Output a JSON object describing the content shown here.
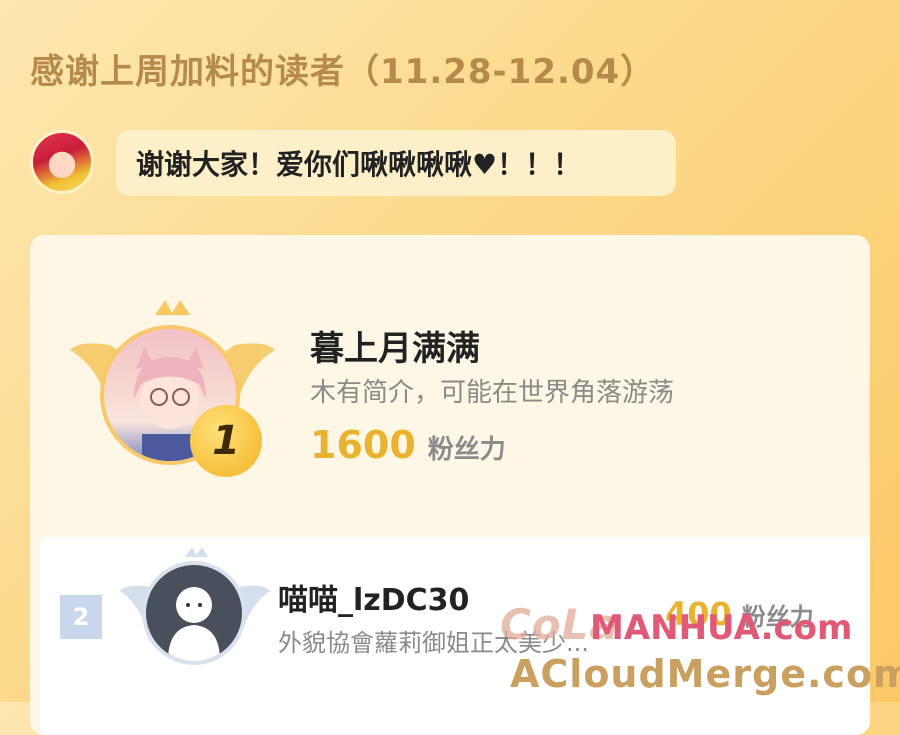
{
  "header": {
    "title": "感谢上周加料的读者（11.28-12.04）"
  },
  "author_message": {
    "text": "谢谢大家！爱你们啾啾啾啾♥！！！"
  },
  "ranking": [
    {
      "rank": "1",
      "name": "暮上月满满",
      "intro": "木有简介，可能在世界角落游荡",
      "fans": "1600",
      "fans_unit": "粉丝力"
    },
    {
      "rank": "2",
      "name": "喵喵_lzDC30",
      "intro": "外貌協會蘿莉御姐正太美少...",
      "fans": "400",
      "fans_unit": "粉丝力"
    }
  ],
  "watermark": {
    "logo": "CoLa",
    "main": "MANHUA.com",
    "sub": "ACloudMerge.com"
  },
  "colors": {
    "accent_gold": "#eab32f",
    "title_brown": "#b58a4a"
  }
}
